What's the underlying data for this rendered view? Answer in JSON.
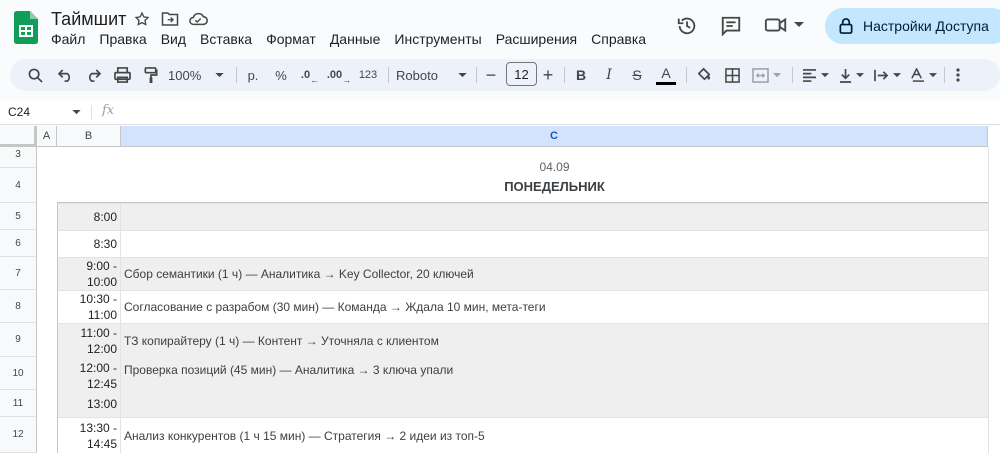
{
  "app": {
    "title": "Таймшит",
    "menu": [
      "Файл",
      "Правка",
      "Вид",
      "Вставка",
      "Формат",
      "Данные",
      "Инструменты",
      "Расширения",
      "Справка"
    ],
    "access_button": "Настройки Доступа"
  },
  "toolbar": {
    "zoom": "100%",
    "currency": "р.",
    "percent": "%",
    "dec_decrease": ".0",
    "dec_increase": ".00",
    "number_format": "123",
    "font": "Roboto",
    "font_size": "12",
    "bold": "B",
    "italic": "I",
    "strikethrough": "S",
    "text_color": "A",
    "text_color_swatch": "#000000"
  },
  "formula_bar": {
    "cell_ref": "C24",
    "fx": "fx",
    "value": ""
  },
  "grid": {
    "columns": [
      "A",
      "B",
      "C"
    ],
    "selected_column": "C",
    "rows": [
      "3",
      "4",
      "5",
      "6",
      "7",
      "8",
      "9",
      "10",
      "11",
      "12"
    ],
    "date": "04.09",
    "weekday": "ПОНЕДЕЛЬНИК",
    "schedule": [
      {
        "time": [
          "8:00"
        ],
        "text": "",
        "shade": "grey"
      },
      {
        "time": [
          "8:30"
        ],
        "text": "",
        "shade": "white"
      },
      {
        "time": [
          "9:00 -",
          "10:00"
        ],
        "text": "Сбор семантики (1 ч) — Аналитика  → Key Collector, 20 ключей",
        "shade": "grey"
      },
      {
        "time": [
          "10:30 -",
          "11:00"
        ],
        "text": "Согласование с разрабом (30 мин) — Команда  → Ждала 10 мин, мета-теги",
        "shade": "white"
      },
      {
        "time": [
          "11:00 -",
          "12:00"
        ],
        "text": "ТЗ копирайтеру (1 ч) — Контент  → Уточняла с клиентом",
        "shade": "grey"
      },
      {
        "time": [
          "12:00 -",
          "12:45"
        ],
        "text": "Проверка позиций (45 мин) — Аналитика → 3 ключа упали",
        "shade": "grey"
      },
      {
        "time": [
          "13:00"
        ],
        "text": "",
        "shade": "grey"
      },
      {
        "time": [
          "13:30 -",
          "14:45"
        ],
        "text": "Анализ конкурентов (1 ч 15 мин) — Стратегия  → 2 идеи из топ-5",
        "shade": "white"
      }
    ]
  },
  "colors": {
    "accent": "#c2e7ff",
    "selected_header": "#d3e3fd",
    "sheets_green": "#0f9d58"
  }
}
